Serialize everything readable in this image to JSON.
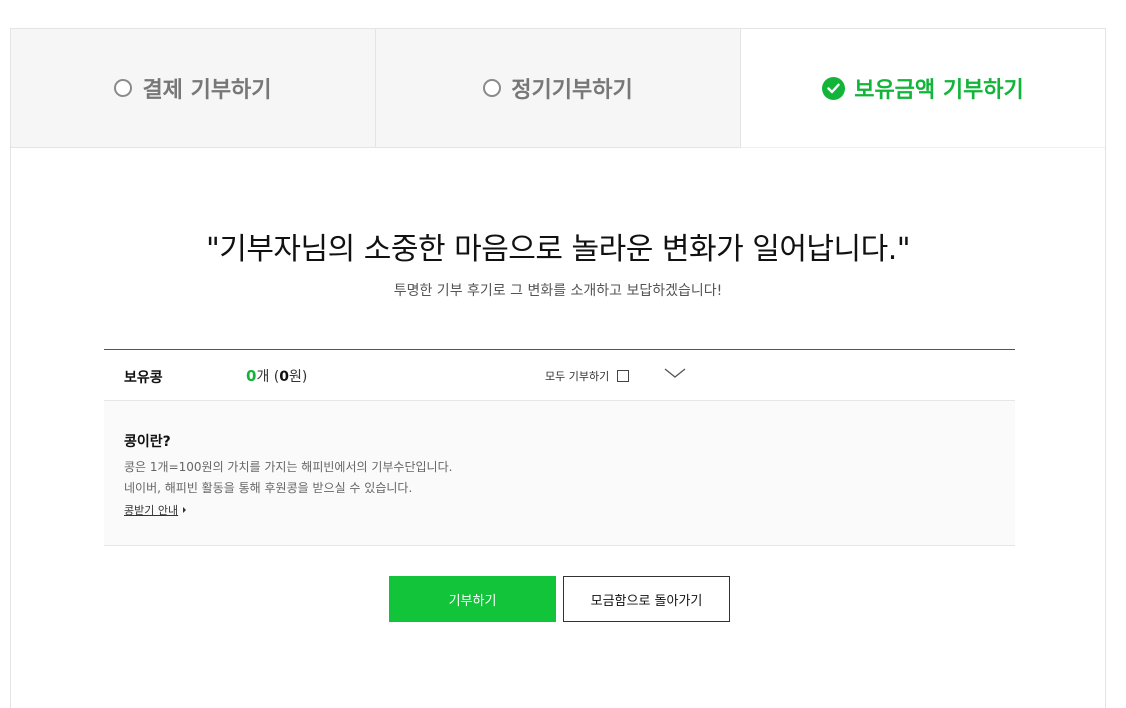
{
  "tabs": [
    {
      "label": "결제 기부하기",
      "state": "unselected",
      "icon": "radio-icon"
    },
    {
      "label": "정기기부하기",
      "state": "unselected",
      "icon": "radio-icon"
    },
    {
      "label": "보유금액 기부하기",
      "state": "selected",
      "icon": "check-circle-icon"
    }
  ],
  "headline": "\"기부자님의 소중한 마음으로 놀라운 변화가 일어납니다.\"",
  "subline": "투명한 기부 후기로 그 변화를 소개하고 보답하겠습니다!",
  "bean": {
    "label": "보유콩",
    "count": "0",
    "count_unit": "개 (",
    "won": "0",
    "won_unit": "원)",
    "all_donate_label": "모두 기부하기",
    "all_donate_checked": false
  },
  "info": {
    "title": "콩이란?",
    "line1": "콩은 1개=100원의 가치를 가지는 해피빈에서의 기부수단입니다.",
    "line2": "네이버, 해피빈 활동을 통해 후원콩을 받으실 수 있습니다.",
    "link": "콩받기 안내"
  },
  "buttons": {
    "donate": "기부하기",
    "back": "모금함으로 돌아가기"
  },
  "colors": {
    "accent": "#12b53a",
    "button_green": "#12c43a"
  }
}
